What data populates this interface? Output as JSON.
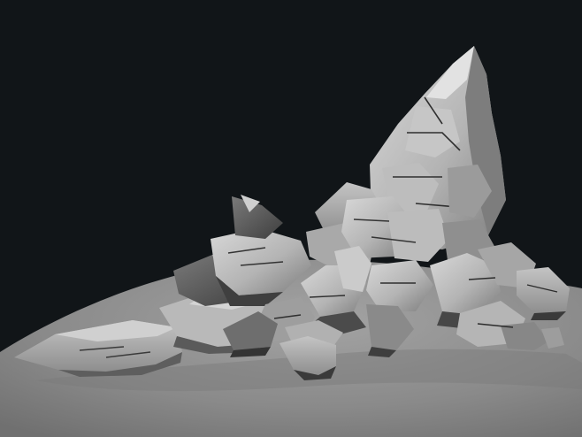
{
  "scene": {
    "background_color": "#111518",
    "ground_color": "#8c8c8c",
    "rock_light": "#c9c9c9",
    "rock_mid": "#9a9a9a",
    "rock_dark": "#4a4a4a",
    "crack_color": "#2b2b2b"
  }
}
